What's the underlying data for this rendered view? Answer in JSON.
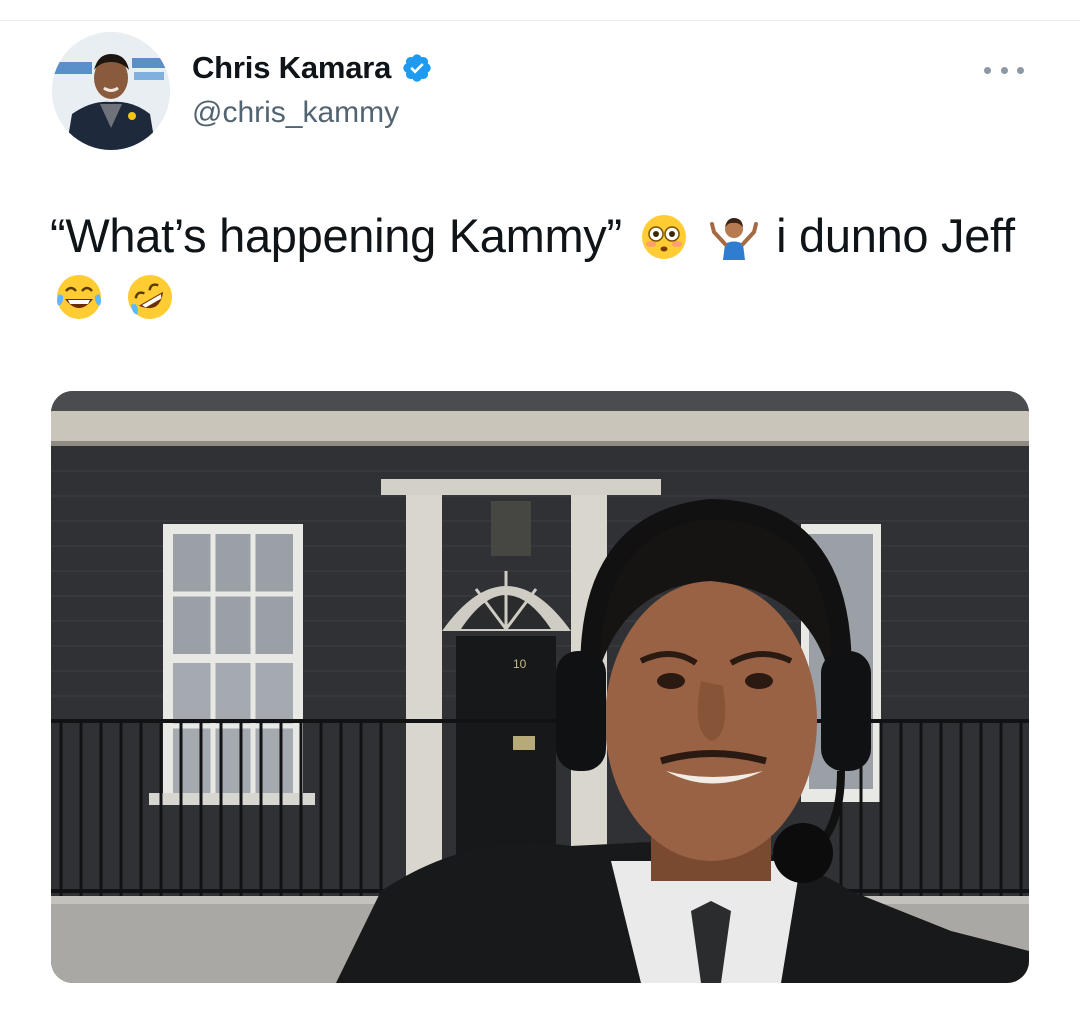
{
  "author": {
    "display_name": "Chris Kamara",
    "handle": "@chris_kammy",
    "verified": true,
    "verified_color": "#1d9bf0",
    "avatar_icon": "profile-photo"
  },
  "tweet": {
    "segments": [
      "“What’s happening Kammy”",
      "i dunno Jeff"
    ],
    "emojis": [
      "flushed-face",
      "person-shrugging",
      "face-with-tears-of-joy",
      "rolling-on-the-floor-laughing"
    ]
  },
  "media": {
    "door_number": "10"
  },
  "menu": {
    "icon": "more-horizontal-icon"
  }
}
